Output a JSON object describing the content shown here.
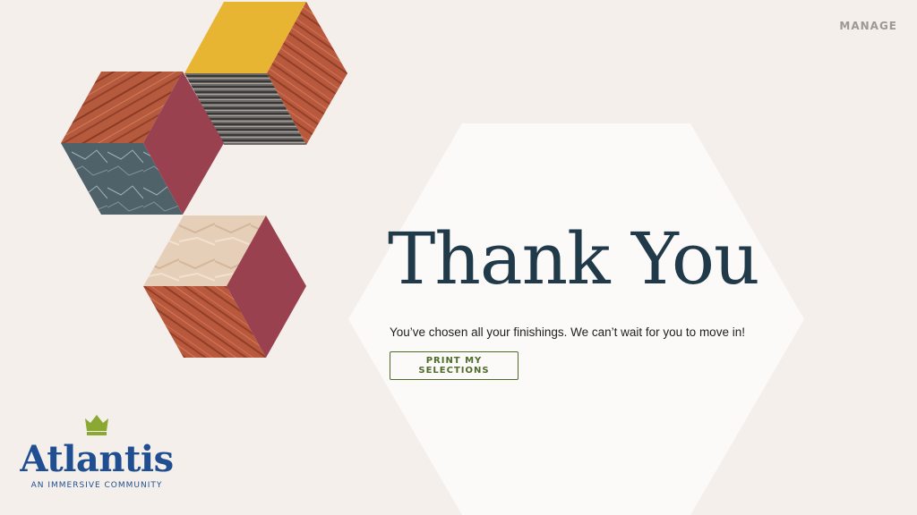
{
  "header": {
    "manage_label": "MANAGE"
  },
  "main": {
    "title": "Thank You",
    "subtitle": "You’ve chosen all your finishings. We can’t wait for you to move in!",
    "print_button_label": "PRINT MY SELECTIONS"
  },
  "brand": {
    "name": "Atlantis",
    "tagline": "AN IMMERSIVE COMMUNITY",
    "crown_icon": "crown-icon"
  },
  "colors": {
    "background": "#f4efeb",
    "hexagon": "#fcfaf8",
    "title": "#213a4a",
    "button_accent": "#4f6b2c",
    "brand_blue": "#1f4f91",
    "crown_green": "#8aa832"
  }
}
